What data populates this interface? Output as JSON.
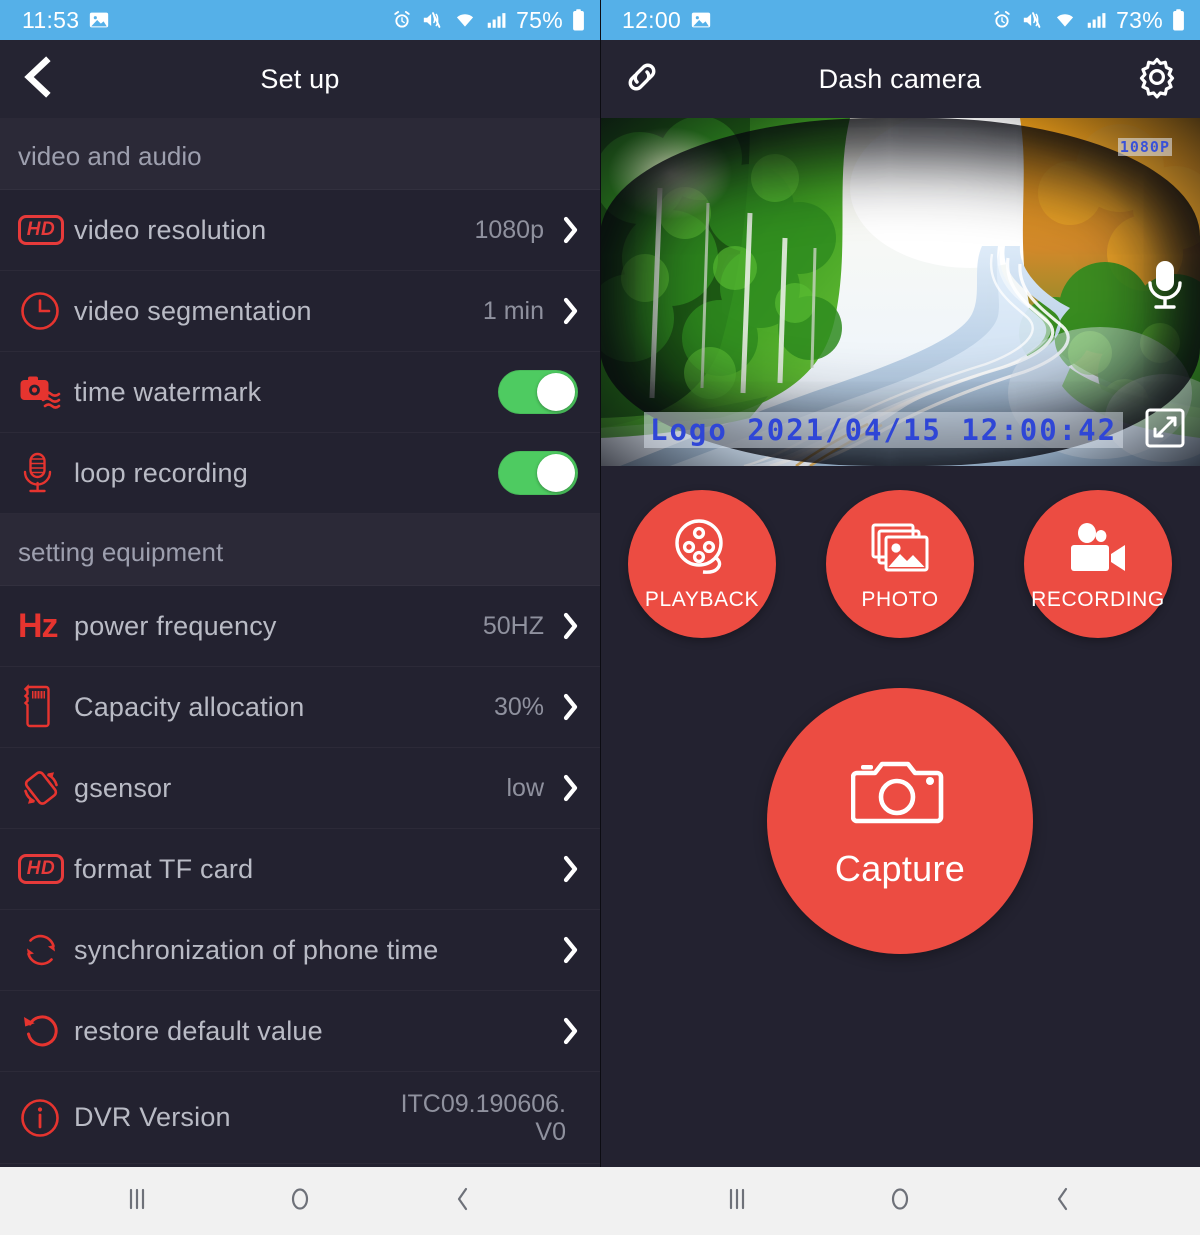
{
  "left": {
    "status_bar": {
      "time": "11:53",
      "battery_pct": "75%",
      "icons": [
        "image-icon",
        "alarm-icon",
        "mute-vibrate-icon",
        "wifi-icon",
        "signal-icon",
        "battery-icon"
      ]
    },
    "app_bar": {
      "title": "Set up",
      "back_icon": "back-chevron-icon"
    },
    "sections": [
      {
        "header": "video and audio",
        "rows": [
          {
            "icon": "hd-icon",
            "label": "video resolution",
            "value": "1080p",
            "type": "nav"
          },
          {
            "icon": "clock-icon",
            "label": "video segmentation",
            "value": "1 min",
            "type": "nav"
          },
          {
            "icon": "camera-wave-icon",
            "label": "time watermark",
            "value": "on",
            "type": "toggle"
          },
          {
            "icon": "microphone-icon",
            "label": "loop recording",
            "value": "on",
            "type": "toggle"
          }
        ]
      },
      {
        "header": "setting equipment",
        "rows": [
          {
            "icon": "hz-icon",
            "label": "power frequency",
            "value": "50HZ",
            "type": "nav"
          },
          {
            "icon": "sd-card-icon",
            "label": "Capacity allocation",
            "value": "30%",
            "type": "nav"
          },
          {
            "icon": "gsensor-icon",
            "label": "gsensor",
            "value": "low",
            "type": "nav"
          },
          {
            "icon": "hd-icon",
            "label": "format TF card",
            "value": "",
            "type": "nav"
          },
          {
            "icon": "sync-icon",
            "label": "synchronization of phone time",
            "value": "",
            "type": "nav"
          },
          {
            "icon": "restore-icon",
            "label": "restore default value",
            "value": "",
            "type": "nav"
          },
          {
            "icon": "info-icon",
            "label": "DVR Version",
            "value": "ITC09.190606.V0",
            "type": "info"
          }
        ]
      }
    ]
  },
  "right": {
    "status_bar": {
      "time": "12:00",
      "battery_pct": "73%",
      "icons": [
        "image-icon",
        "alarm-icon",
        "mute-vibrate-icon",
        "wifi-icon",
        "signal-icon",
        "battery-icon"
      ]
    },
    "app_bar": {
      "title": "Dash camera",
      "link_icon": "link-icon",
      "settings_icon": "gear-icon"
    },
    "video": {
      "resolution_badge": "1080P",
      "watermark": "Logo 2021/04/15 12:00:42",
      "mic_icon": "microphone-icon",
      "expand_icon": "fullscreen-expand-icon"
    },
    "actions": [
      {
        "label": "PLAYBACK",
        "icon": "film-reel-icon"
      },
      {
        "label": "PHOTO",
        "icon": "photo-stack-icon"
      },
      {
        "label": "RECORDING",
        "icon": "video-camera-icon"
      }
    ],
    "capture": {
      "label": "Capture",
      "icon": "camera-icon"
    }
  },
  "nav_bar": {
    "buttons": [
      {
        "name": "recents",
        "icon": "recents-icon"
      },
      {
        "name": "home",
        "icon": "home-circle-icon"
      },
      {
        "name": "back",
        "icon": "back-chevron-icon"
      }
    ]
  },
  "colors": {
    "status_bar": "#55b0e8",
    "app_bar": "#252432",
    "row_bg": "#232230",
    "section_bg": "#2b2937",
    "accent_red": "#e6342f",
    "button_red": "#ec4c42",
    "toggle_green": "#4ecb61",
    "watermark_blue": "#2f46d6",
    "label_gray": "#b9bbc5",
    "value_gray": "#8f919e"
  }
}
